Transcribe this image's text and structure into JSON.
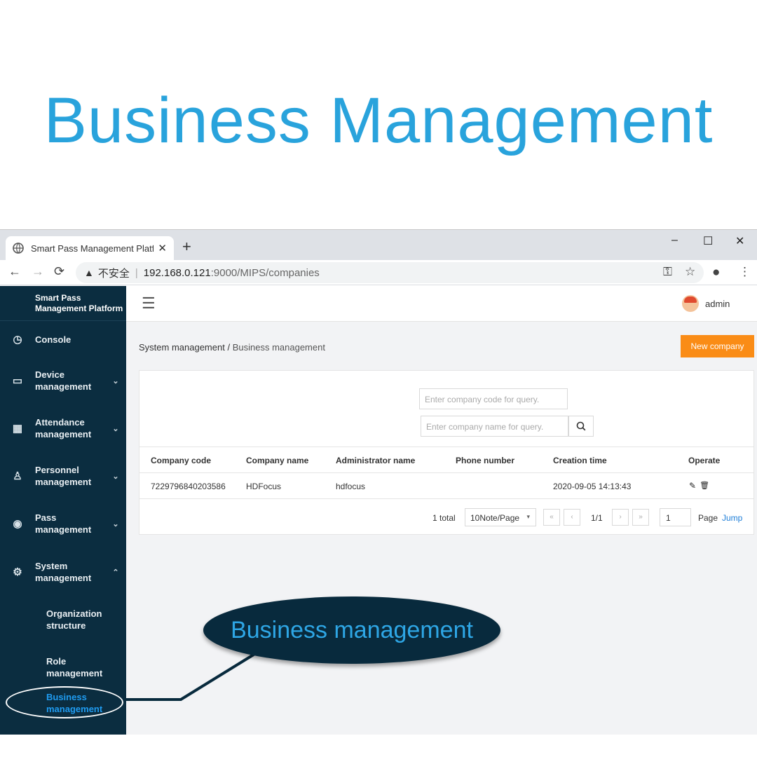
{
  "headline": "Business Management",
  "browser": {
    "tab_title": "Smart Pass Management Platf",
    "tab_close": "✕",
    "new_tab": "+",
    "min": "–",
    "max": "☐",
    "close": "✕",
    "back": "←",
    "forward": "→",
    "reload": "⟳",
    "warning_icon": "▲",
    "insecure_label": "不安全",
    "separator": "|",
    "url_host": "192.168.0.121",
    "url_path": ":9000/MIPS/companies",
    "key_icon": "⚿",
    "star_icon": "☆",
    "profile_icon": "●",
    "menu_icon": "⋮"
  },
  "app": {
    "brand": "Smart Pass Management Platform",
    "user": "admin",
    "menu": [
      {
        "label": "Console",
        "icon": "◷"
      },
      {
        "label": "Device management",
        "icon": "▭",
        "chevron": "⌄"
      },
      {
        "label": "Attendance management",
        "icon": "▦",
        "chevron": "⌄"
      },
      {
        "label": "Personnel management",
        "icon": "♙",
        "chevron": "⌄"
      },
      {
        "label": "Pass management",
        "icon": "◉",
        "chevron": "⌄"
      },
      {
        "label": "System management",
        "icon": "⚙",
        "chevron": "⌃"
      }
    ],
    "submenu": [
      "Organization structure",
      "Role management",
      "Business management"
    ],
    "collapse_icon": "☰",
    "breadcrumb": {
      "parent": "System management",
      "sep": "/",
      "current": "Business management"
    },
    "new_company": "New company",
    "query": {
      "code_placeholder": "Enter company code for query.",
      "name_placeholder": "Enter company name for query.",
      "search_icon": "⚲"
    },
    "table": {
      "headers": [
        "Company code",
        "Company name",
        "Administrator name",
        "Phone number",
        "Creation time",
        "Operate"
      ],
      "rows": [
        {
          "code": "7229796840203586",
          "name": "HDFocus",
          "admin": "hdfocus",
          "phone": "",
          "created": "2020-09-05 14:13:43",
          "edit_icon": "✎",
          "delete_icon": "🗑"
        }
      ]
    },
    "pager": {
      "total": "1 total",
      "page_size": "10Note/Page",
      "caret": "▾",
      "first": "«",
      "prev": "‹",
      "pages": "1/1",
      "next": "›",
      "last": "»",
      "page_input": "1",
      "page_label": "Page",
      "jump": "Jump"
    }
  },
  "callout": "Business management",
  "colors": {
    "accent": "#29a3dc",
    "sidebar": "#0b2d40",
    "orange": "#fa8c16",
    "active": "#1f9bf0"
  }
}
